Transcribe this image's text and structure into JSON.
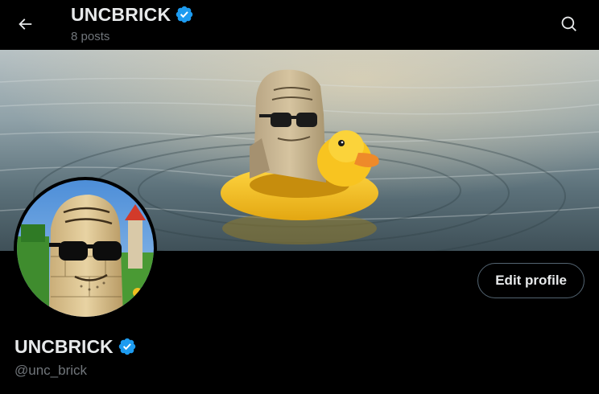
{
  "header": {
    "title": "UNCBRICK",
    "posts_count": "8 posts",
    "verified": true
  },
  "profile": {
    "display_name": "UNCBRICK",
    "handle": "@unc_brick",
    "verified": true,
    "edit_label": "Edit profile"
  },
  "icons": {
    "back": "arrow-left-icon",
    "search": "search-icon",
    "verified": "verified-badge-icon"
  },
  "colors": {
    "background": "#000000",
    "text_primary": "#e7e9ea",
    "text_secondary": "#71767b",
    "verified_blue": "#1d9bf0",
    "button_border": "#536471"
  }
}
